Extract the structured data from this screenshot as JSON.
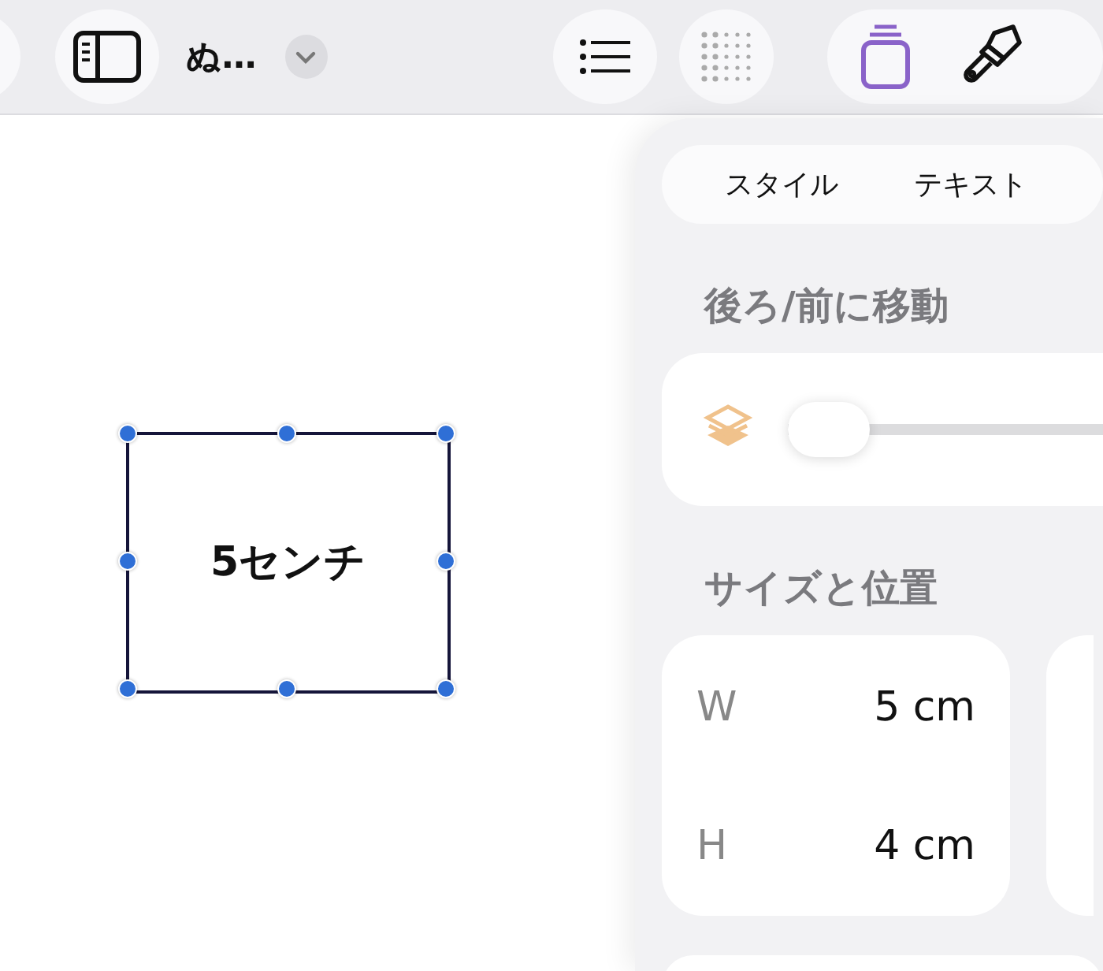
{
  "toolbar": {
    "title": "ぬ…",
    "tools": [
      {
        "kind": "stack",
        "selected": true
      },
      {
        "kind": "brush",
        "selected": false
      }
    ]
  },
  "canvas": {
    "shape_label": "5センチ",
    "selected": true
  },
  "panel": {
    "tabs": [
      {
        "label": "スタイル"
      },
      {
        "label": "テキスト"
      }
    ],
    "arrange": {
      "heading": "後ろ/前に移動",
      "level": 0
    },
    "size_position": {
      "heading": "サイズと位置",
      "fields": [
        {
          "label": "W",
          "value": "5 cm"
        },
        {
          "label": "H",
          "value": "4 cm"
        }
      ]
    }
  }
}
